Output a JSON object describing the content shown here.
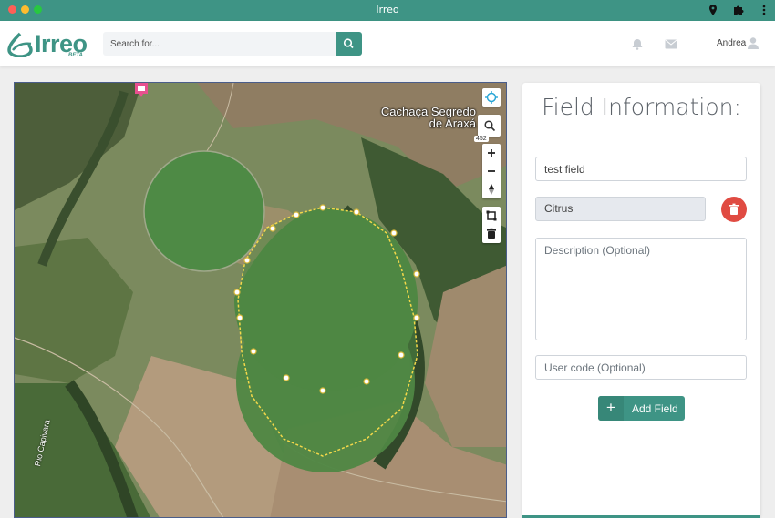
{
  "window": {
    "title": "Irreo"
  },
  "header": {
    "logo_text": "Irreo",
    "logo_badge": "BETA",
    "search_placeholder": "Search for...",
    "user_name": "Andrea"
  },
  "map": {
    "place_label": "Cachaça Segredo de Araxá",
    "river_label": "Rio Capivara",
    "zoom_badge": "452",
    "controls": [
      "locate-icon",
      "search-icon",
      "zoom-in-icon",
      "zoom-out-icon",
      "compass-icon",
      "draw-polygon-icon",
      "trash-icon"
    ]
  },
  "panel": {
    "title": "Field Information:",
    "field_name_value": "test field",
    "crop_value": "Citrus",
    "description_placeholder": "Description (Optional)",
    "user_code_placeholder": "User code (Optional)",
    "add_button_label": "Add Field",
    "add_button_icon": "+"
  },
  "colors": {
    "brand": "#3e9485",
    "danger": "#e04b42",
    "polygon": "#f3d84a"
  }
}
